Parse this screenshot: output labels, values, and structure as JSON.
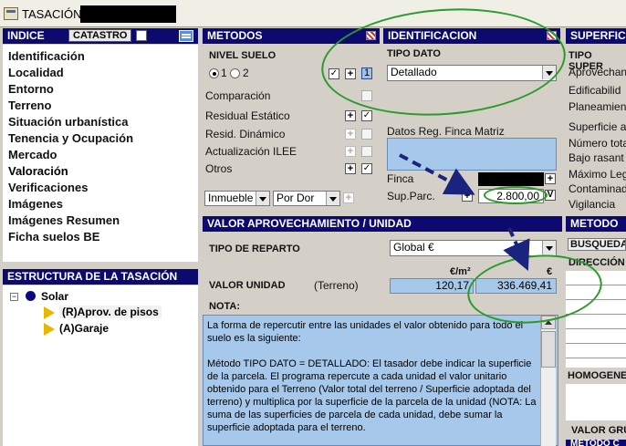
{
  "window": {
    "title": "TASACIÓN_"
  },
  "indice": {
    "header": "INDICE",
    "catastro_button": "CATASTRO",
    "items": [
      {
        "label": "Identificación"
      },
      {
        "label": "Localidad"
      },
      {
        "label": "Entorno"
      },
      {
        "label": "Terreno"
      },
      {
        "label": "Situación urbanística"
      },
      {
        "label": "Tenencia y Ocupación"
      },
      {
        "label": "Mercado"
      },
      {
        "label": "Valoración"
      },
      {
        "label": "Verificaciones"
      },
      {
        "label": "Imágenes"
      },
      {
        "label": "Imágenes Resumen"
      },
      {
        "label": "Ficha suelos BE"
      }
    ]
  },
  "estructura": {
    "header": "ESTRUCTURA DE LA TASACIÓN",
    "root": "Solar",
    "children": [
      "(R)Aprov. de pisos",
      "(A)Garaje"
    ]
  },
  "metodos": {
    "header": "METODOS",
    "nivel_suelo_label": "NIVEL SUELO",
    "radio1": "1",
    "radio2": "2",
    "nivel_value": "1",
    "rows": [
      "Comparación",
      "Residual Estático",
      "Resid. Dinámico",
      "Actualización ILEE",
      "Otros"
    ],
    "combo1": "Inmueble",
    "combo2": "Por Dor",
    "plus": "+",
    "check": "✓"
  },
  "identificacion": {
    "header": "IDENTIFICACION",
    "tipo_dato_label": "TIPO DATO",
    "tipo_dato_value": "Detallado",
    "datos_reg_label": "Datos Reg. Finca Matriz",
    "finca_label": "Finca",
    "sup_parc_label": "Sup.Parc.",
    "sup_parc_value": "2.800,00",
    "v_button": "V"
  },
  "superficie": {
    "header": "SUPERFIC",
    "labels": [
      "TIPO SUPER",
      "Aprovechan",
      "Edificabilid",
      "Planeamien",
      "Superficie a",
      "Número tota",
      "Bajo rasant",
      "Máximo Leg",
      "Contaminad",
      "Vigilancia"
    ]
  },
  "metodo_right": {
    "header": "METODO",
    "busqueda": "BUSQUEDA I",
    "direccion": "DIRECCIÓN",
    "homogen": "HOMOGENEI",
    "valor_gru": "VALOR GRU",
    "metodo_cut": "MÉTODO C"
  },
  "valor": {
    "header": "VALOR APROVECHAMIENTO / UNIDAD",
    "tipo_reparto_label": "TIPO DE REPARTO",
    "tipo_reparto_value": "Global €",
    "unit_header_m2": "€/m²",
    "unit_header_eur": "€",
    "valor_unidad_label": "VALOR UNIDAD",
    "terreno_label": "(Terreno)",
    "valor_m2": "120,17",
    "valor_eur": "336.469,41",
    "nota_label": "NOTA:",
    "nota_text": "La forma de repercutir entre las unidades el valor obtenido para todo el suelo es la siguiente:\n\nMétodo TIPO DATO = DETALLADO: El tasador debe indicar la superficie de la parcela. El programa repercute a cada unidad el valor unitario obtenido para el Terreno (Valor total del terreno / Superficie adoptada del terreno) y multiplica por la superficie de la parcela de la unidad (NOTA: La suma de las superficies de parcela de cada unidad, debe sumar la superficie adoptada para el terreno."
  },
  "colors": {
    "header_bg": "#0c0a6e",
    "field_blue": "#a6c8ea",
    "annotation_green": "#2a9a2a",
    "arrow_navy": "#1a237e"
  }
}
